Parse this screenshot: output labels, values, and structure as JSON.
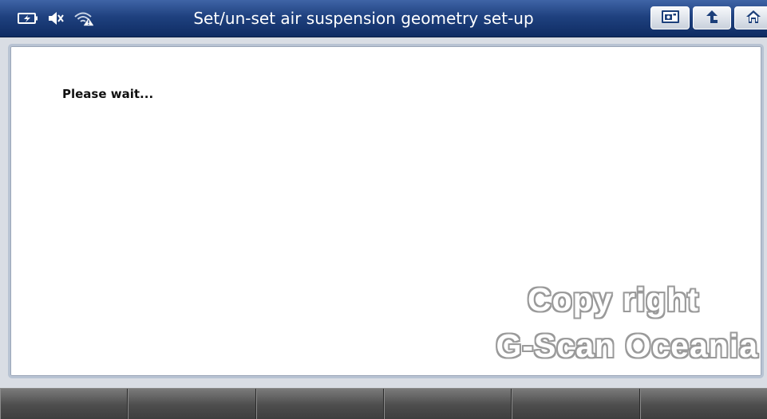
{
  "titlebar": {
    "title": "Set/un-set air suspension geometry set-up",
    "status_icons": [
      "battery-charging-icon",
      "speaker-muted-icon",
      "wifi-warning-icon"
    ],
    "buttons": [
      "screen-capture-icon",
      "back-arrow-icon",
      "home-icon"
    ]
  },
  "content": {
    "message": "Please wait...",
    "watermark_line1": "Copy right",
    "watermark_line2": "G-Scan Oceania"
  },
  "function_keys": [
    "",
    "",
    "",
    "",
    "",
    ""
  ],
  "colors": {
    "titlebar_top": "#3f64a6",
    "titlebar_bottom": "#0f2c63",
    "panel_border": "#b8c3d3",
    "function_key": "#4d4d4d"
  }
}
